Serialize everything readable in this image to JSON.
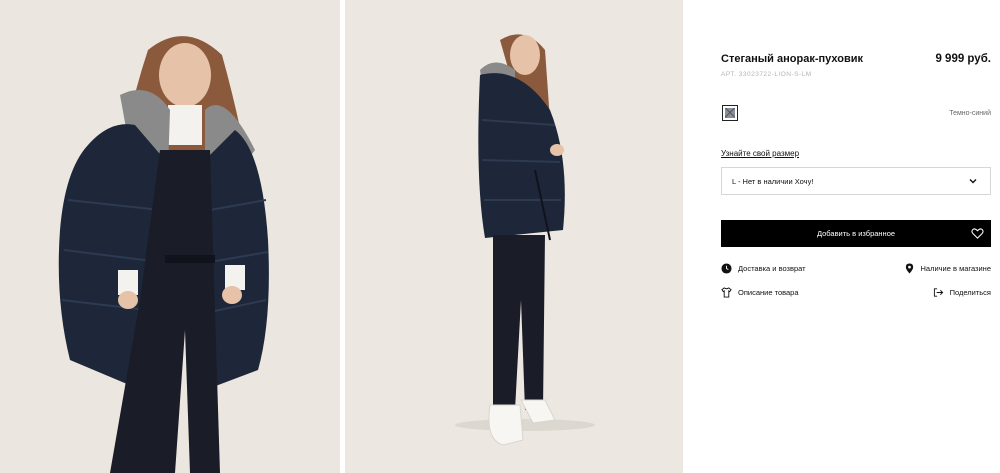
{
  "product": {
    "title": "Стеганый анорак-пуховик",
    "price": "9 999 руб.",
    "sku": "АРТ. 33023722-LION-S-LM",
    "color_name": "Темно-синий",
    "size_guide_label": "Узнайте свой размер",
    "size_selected": "L - Нет в наличии Хочу!",
    "add_button_label": "Добавить в избранное",
    "delivery_label": "Доставка и возврат",
    "store_availability_label": "Наличие в магазине",
    "description_label": "Описание товара",
    "share_label": "Поделиться"
  },
  "colors": {
    "accent": "#000000",
    "photo_background": "#ece8e1",
    "swatch": "#8a8f99"
  },
  "icons": [
    "clock-icon",
    "map-pin-icon",
    "shirt-icon",
    "share-icon",
    "heart-icon",
    "chevron-down-icon",
    "swatch-icon"
  ]
}
